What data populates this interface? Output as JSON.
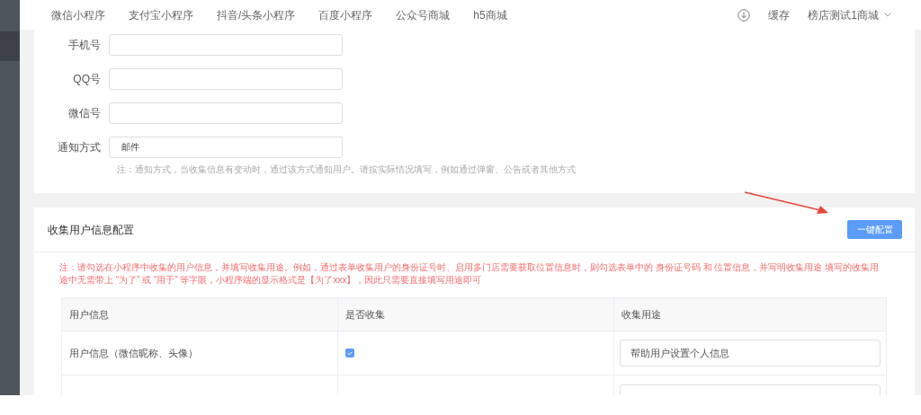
{
  "top_nav": {
    "tabs": [
      {
        "label": "微信小程序",
        "selected": false
      },
      {
        "label": "支付宝小程序",
        "selected": false
      },
      {
        "label": "抖音/头条小程序",
        "selected": false
      },
      {
        "label": "百度小程序",
        "selected": false
      },
      {
        "label": "公众号商城",
        "selected": false
      },
      {
        "label": "h5商城",
        "selected": false
      }
    ],
    "cache": "缓存",
    "store": "榜店测试1商城"
  },
  "contact_form": {
    "fields": [
      {
        "label": "手机号"
      },
      {
        "label": "QQ号"
      },
      {
        "label": "微信号"
      },
      {
        "label": "通知方式",
        "value": "邮件"
      }
    ],
    "hint": "注：通知方式，当收集信息有变动时，通过该方式通知用户。请按实际情况填写，例如通过弹窗、公告或者其他方式"
  },
  "collect_config": {
    "title": "收集用户信息配置",
    "button": "一键配置",
    "note": "注：请勾选在小程序中收集的用户信息，并填写收集用途。例如，通过表单收集用户的身份证号时、启用多门店需要获取位置信息时，则勾选表单中的 身份证号码 和 位置信息，并写明收集用途 填写的收集用途中无需带上 “为了” 或 “用于” 等字眼，小程序端的显示格式是【为了xxx】，因此只需要直接填写用途即可",
    "columns": [
      "用户信息",
      "是否收集",
      "收集用途"
    ],
    "rows": [
      {
        "info": "用户信息（微信昵称、头像）",
        "collected": true,
        "purpose": "帮助用户设置个人信息"
      }
    ]
  }
}
